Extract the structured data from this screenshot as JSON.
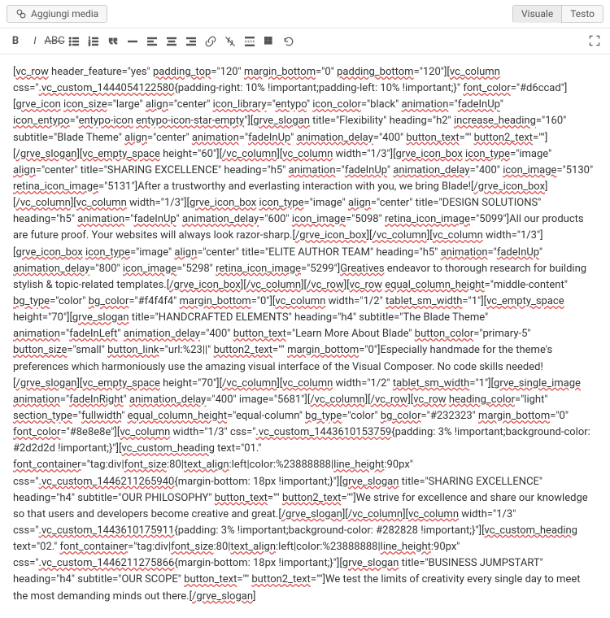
{
  "media_button": "Aggiungi media",
  "tabs": {
    "visual": "Visuale",
    "text": "Testo"
  },
  "content": "[vc_row header_feature=\"yes\" padding_top=\"120\" margin_bottom=\"0\" padding_bottom=\"120\"][vc_column css=\".vc_custom_1444054122580{padding-right: 10% !important;padding-left: 10% !important;}\" font_color=\"#d6ccad\"][grve_icon icon_size=\"large\" align=\"center\" icon_library=\"entypo\" icon_color=\"black\" animation=\"fadeInUp\" icon_entypo=\"entypo-icon entypo-icon-star-empty\"][grve_slogan title=\"Flexibility\" heading=\"h2\" increase_heading=\"160\" subtitle=\"Blade Theme\" align=\"center\" animation=\"fadeInUp\" animation_delay=\"400\" button_text=\"\" button2_text=\"\"][/grve_slogan][vc_empty_space height=\"60\"][/vc_column][vc_column width=\"1/3\"][grve_icon_box icon_type=\"image\" align=\"center\" title=\"SHARING EXCELLENCE\" heading=\"h5\" animation=\"fadeInUp\" animation_delay=\"400\" icon_image=\"5130\" retina_icon_image=\"5131\"]After a trustworthy and everlasting interaction with you, we bring Blade![/grve_icon_box][/vc_column][vc_column width=\"1/3\"][grve_icon_box icon_type=\"image\" align=\"center\" title=\"DESIGN SOLUTIONS\" heading=\"h5\" animation=\"fadeInUp\" animation_delay=\"600\" icon_image=\"5098\" retina_icon_image=\"5099\"]All our products are future proof. Your websites will always look razor-sharp.[/grve_icon_box][/vc_column][vc_column width=\"1/3\"][grve_icon_box icon_type=\"image\" align=\"center\" title=\"ELITE AUTHOR TEAM\" heading=\"h5\" animation=\"fadeInUp\" animation_delay=\"800\" icon_image=\"5298\" retina_icon_image=\"5299\"]Greatives endeavor to thorough research for building stylish & topic-related templates.[/grve_icon_box][/vc_column][/vc_row][vc_row equal_column_height=\"middle-content\" bg_type=\"color\" bg_color=\"#f4f4f4\" margin_bottom=\"0\"][vc_column width=\"1/2\" tablet_sm_width=\"1\"][vc_empty_space height=\"70\"][grve_slogan title=\"HANDCRAFTED ELEMENTS\" heading=\"h4\" subtitle=\"The Blade Theme\" animation=\"fadeInLeft\" animation_delay=\"400\" button_text=\"Learn More About Blade\" button_color=\"primary-5\" button_size=\"small\" button_link=\"url:%23||\" button2_text=\"\" margin_bottom=\"0\"]Especially handmade for the theme's preferences which harmoniously use the amazing visual interface of the Visual Composer. No code skills needed![/grve_slogan][vc_empty_space height=\"70\"][/vc_column][vc_column width=\"1/2\" tablet_sm_width=\"1\"][grve_single_image animation=\"fadeInRight\" animation_delay=\"400\" image=\"5681\"][/vc_column][/vc_row][vc_row heading_color=\"light\" section_type=\"fullwidth\" equal_column_height=\"equal-column\" bg_type=\"color\" bg_color=\"#232323\" margin_bottom=\"0\" font_color=\"#8e8e8e\"][vc_column width=\"1/3\" css=\".vc_custom_1443610153759{padding: 3% !important;background-color: #2d2d2d !important;}\"][vc_custom_heading text=\"01.\" font_container=\"tag:div|font_size:80|text_align:left|color:%23888888|line_height:90px\" css=\".vc_custom_1446211265940{margin-bottom: 18px !important;}\"][grve_slogan title=\"SHARING EXCELLENCE\" heading=\"h4\" subtitle=\"OUR PHILOSOPHY\" button_text=\"\" button2_text=\"\"]We strive for excellence and share our knowledge so that users and developers become creative and great.[/grve_slogan][/vc_column][vc_column width=\"1/3\" css=\".vc_custom_1443610175911{padding: 3% !important;background-color: #282828 !important;}\"][vc_custom_heading text=\"02.\" font_container=\"tag:div|font_size:80|text_align:left|color:%23888888|line_height:90px\" css=\".vc_custom_1446211275866{margin-bottom: 18px !important;}\"][grve_slogan title=\"BUSINESS JUMPSTART\" heading=\"h4\" subtitle=\"OUR SCOPE\" button_text=\"\" button2_text=\"\"]We test the limits of creativity every single day to meet the most demanding minds out there.[/grve_slogan]"
}
